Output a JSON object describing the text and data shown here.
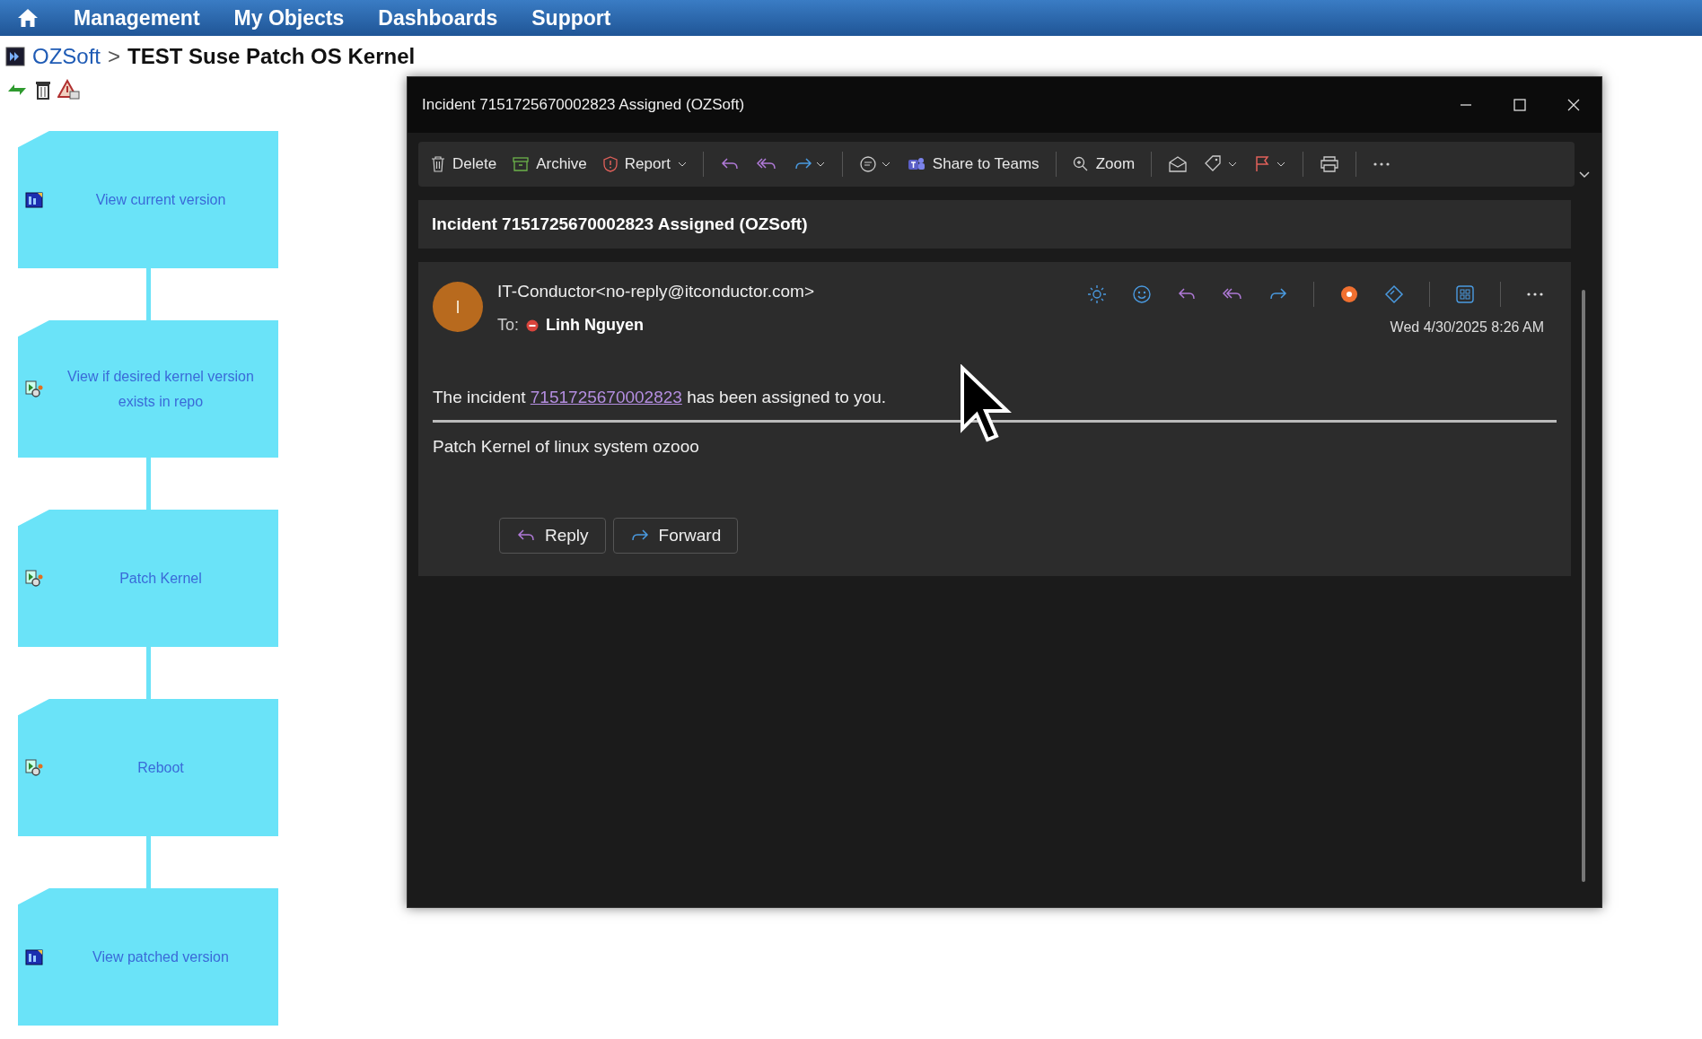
{
  "nav": {
    "items": [
      "Management",
      "My Objects",
      "Dashboards",
      "Support"
    ]
  },
  "breadcrumb": {
    "parent": "OZSoft",
    "separator": ">",
    "title": "TEST Suse Patch OS Kernel"
  },
  "flow": {
    "nodes": [
      {
        "label": "View current version",
        "kind": "view"
      },
      {
        "label": "View if desired kernel version exists in repo",
        "kind": "task"
      },
      {
        "label": "Patch Kernel",
        "kind": "task"
      },
      {
        "label": "Reboot",
        "kind": "task"
      },
      {
        "label": "View patched version",
        "kind": "view"
      }
    ]
  },
  "mail_window": {
    "title": "Incident 7151725670002823 Assigned (OZSoft)",
    "toolbar": {
      "delete": "Delete",
      "archive": "Archive",
      "report": "Report",
      "share": "Share to Teams",
      "zoom": "Zoom"
    },
    "subject": "Incident 7151725670002823 Assigned (OZSoft)",
    "message": {
      "avatar_initial": "I",
      "from": "IT-Conductor<no-reply@itconductor.com>",
      "to_label": "To:",
      "recipient": "Linh Nguyen",
      "date": "Wed 4/30/2025 8:26 AM",
      "body_before": "The incident ",
      "link": "7151725670002823",
      "body_after": " has been assigned to you.",
      "description": "Patch Kernel of linux system ozooo",
      "reply": "Reply",
      "forward": "Forward"
    }
  }
}
